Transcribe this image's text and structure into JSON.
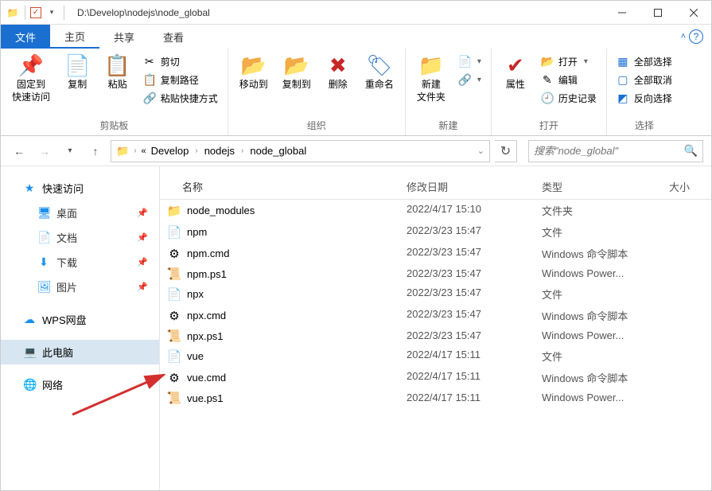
{
  "titlebar": {
    "path": "D:\\Develop\\nodejs\\node_global"
  },
  "tabs": {
    "file": "文件",
    "home": "主页",
    "share": "共享",
    "view": "查看"
  },
  "ribbon": {
    "clipboard": {
      "label": "剪贴板",
      "pin": "固定到\n快速访问",
      "copy": "复制",
      "paste": "粘贴",
      "cut": "剪切",
      "copypath": "复制路径",
      "pasteShortcut": "粘贴快捷方式"
    },
    "organize": {
      "label": "组织",
      "moveto": "移动到",
      "copyto": "复制到",
      "delete": "删除",
      "rename": "重命名"
    },
    "new": {
      "label": "新建",
      "newfolder": "新建\n文件夹"
    },
    "open": {
      "label": "打开",
      "properties": "属性",
      "open": "打开",
      "edit": "编辑",
      "history": "历史记录"
    },
    "select": {
      "label": "选择",
      "all": "全部选择",
      "none": "全部取消",
      "invert": "反向选择"
    }
  },
  "breadcrumb": [
    "Develop",
    "nodejs",
    "node_global"
  ],
  "search": {
    "placeholder": "搜索\"node_global\""
  },
  "sidebar": {
    "quick": {
      "label": "快速访问",
      "items": [
        "桌面",
        "文档",
        "下载",
        "图片"
      ]
    },
    "wps": "WPS网盘",
    "pc": "此电脑",
    "net": "网络"
  },
  "columns": {
    "name": "名称",
    "date": "修改日期",
    "type": "类型",
    "size": "大小"
  },
  "files": [
    {
      "name": "node_modules",
      "date": "2022/4/17 15:10",
      "type": "文件夹",
      "icon": "folder"
    },
    {
      "name": "npm",
      "date": "2022/3/23 15:47",
      "type": "文件",
      "icon": "file"
    },
    {
      "name": "npm.cmd",
      "date": "2022/3/23 15:47",
      "type": "Windows 命令脚本",
      "icon": "cmd"
    },
    {
      "name": "npm.ps1",
      "date": "2022/3/23 15:47",
      "type": "Windows Power...",
      "icon": "ps1"
    },
    {
      "name": "npx",
      "date": "2022/3/23 15:47",
      "type": "文件",
      "icon": "file"
    },
    {
      "name": "npx.cmd",
      "date": "2022/3/23 15:47",
      "type": "Windows 命令脚本",
      "icon": "cmd"
    },
    {
      "name": "npx.ps1",
      "date": "2022/3/23 15:47",
      "type": "Windows Power...",
      "icon": "ps1"
    },
    {
      "name": "vue",
      "date": "2022/4/17 15:11",
      "type": "文件",
      "icon": "file"
    },
    {
      "name": "vue.cmd",
      "date": "2022/4/17 15:11",
      "type": "Windows 命令脚本",
      "icon": "cmd"
    },
    {
      "name": "vue.ps1",
      "date": "2022/4/17 15:11",
      "type": "Windows Power...",
      "icon": "ps1"
    }
  ]
}
